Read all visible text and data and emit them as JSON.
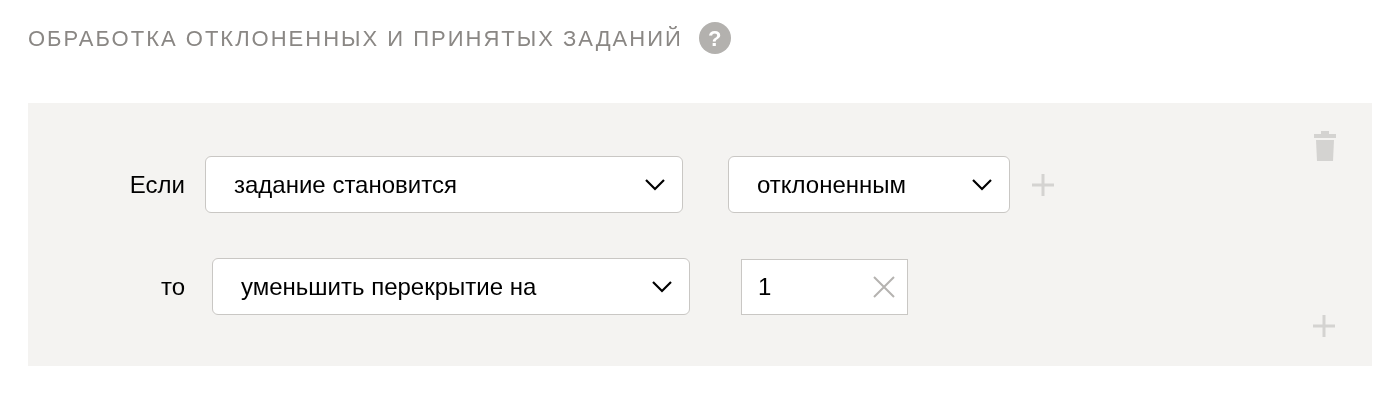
{
  "title": "ОБРАБОТКА ОТКЛОНЕННЫХ И ПРИНЯТЫХ ЗАДАНИЙ",
  "help": "?",
  "rules": [
    {
      "kind": "condition",
      "label": "Если",
      "select": "задание становится",
      "value_select": "отклоненным"
    },
    {
      "kind": "action",
      "label": "то",
      "select": "уменьшить перекрытие на",
      "input": {
        "value": "1"
      }
    }
  ]
}
